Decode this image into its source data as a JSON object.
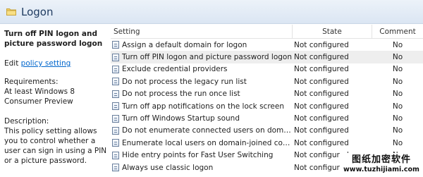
{
  "header": {
    "title": "Logon",
    "icon": "folder-icon"
  },
  "description": {
    "title": "Turn off PIN logon and picture password logon",
    "edit_prefix": "Edit ",
    "edit_link": "policy setting",
    "requirements_label": "Requirements:",
    "requirements_text": "At least Windows 8 Consumer Preview",
    "description_label": "Description:",
    "description_text": "This policy setting allows you to control whether a user can sign in using a PIN or a picture password."
  },
  "columns": {
    "setting": "Setting",
    "state": "State",
    "comment": "Comment"
  },
  "rows": [
    {
      "setting": "Assign a default domain for logon",
      "state": "Not configured",
      "comment": "No"
    },
    {
      "setting": "Turn off PIN logon and picture password logon",
      "state": "Not configured",
      "comment": "No"
    },
    {
      "setting": "Exclude credential providers",
      "state": "Not configured",
      "comment": "No"
    },
    {
      "setting": "Do not process the legacy run list",
      "state": "Not configured",
      "comment": "No"
    },
    {
      "setting": "Do not process the run once list",
      "state": "Not configured",
      "comment": "No"
    },
    {
      "setting": "Turn off app notifications on the lock screen",
      "state": "Not configured",
      "comment": "No"
    },
    {
      "setting": "Turn off Windows Startup sound",
      "state": "Not configured",
      "comment": "No"
    },
    {
      "setting": "Do not enumerate connected users on domain-j...",
      "state": "Not configured",
      "comment": "No"
    },
    {
      "setting": "Enumerate local users on domain-joined compu...",
      "state": "Not configured",
      "comment": "No"
    },
    {
      "setting": "Hide entry points for Fast User Switching",
      "state": "Not configured",
      "comment": "No"
    },
    {
      "setting": "Always use classic logon",
      "state": "Not configured",
      "comment": "No"
    }
  ],
  "watermark": {
    "cn": "图纸加密软件",
    "url": "www.tuzhijiami.com"
  }
}
